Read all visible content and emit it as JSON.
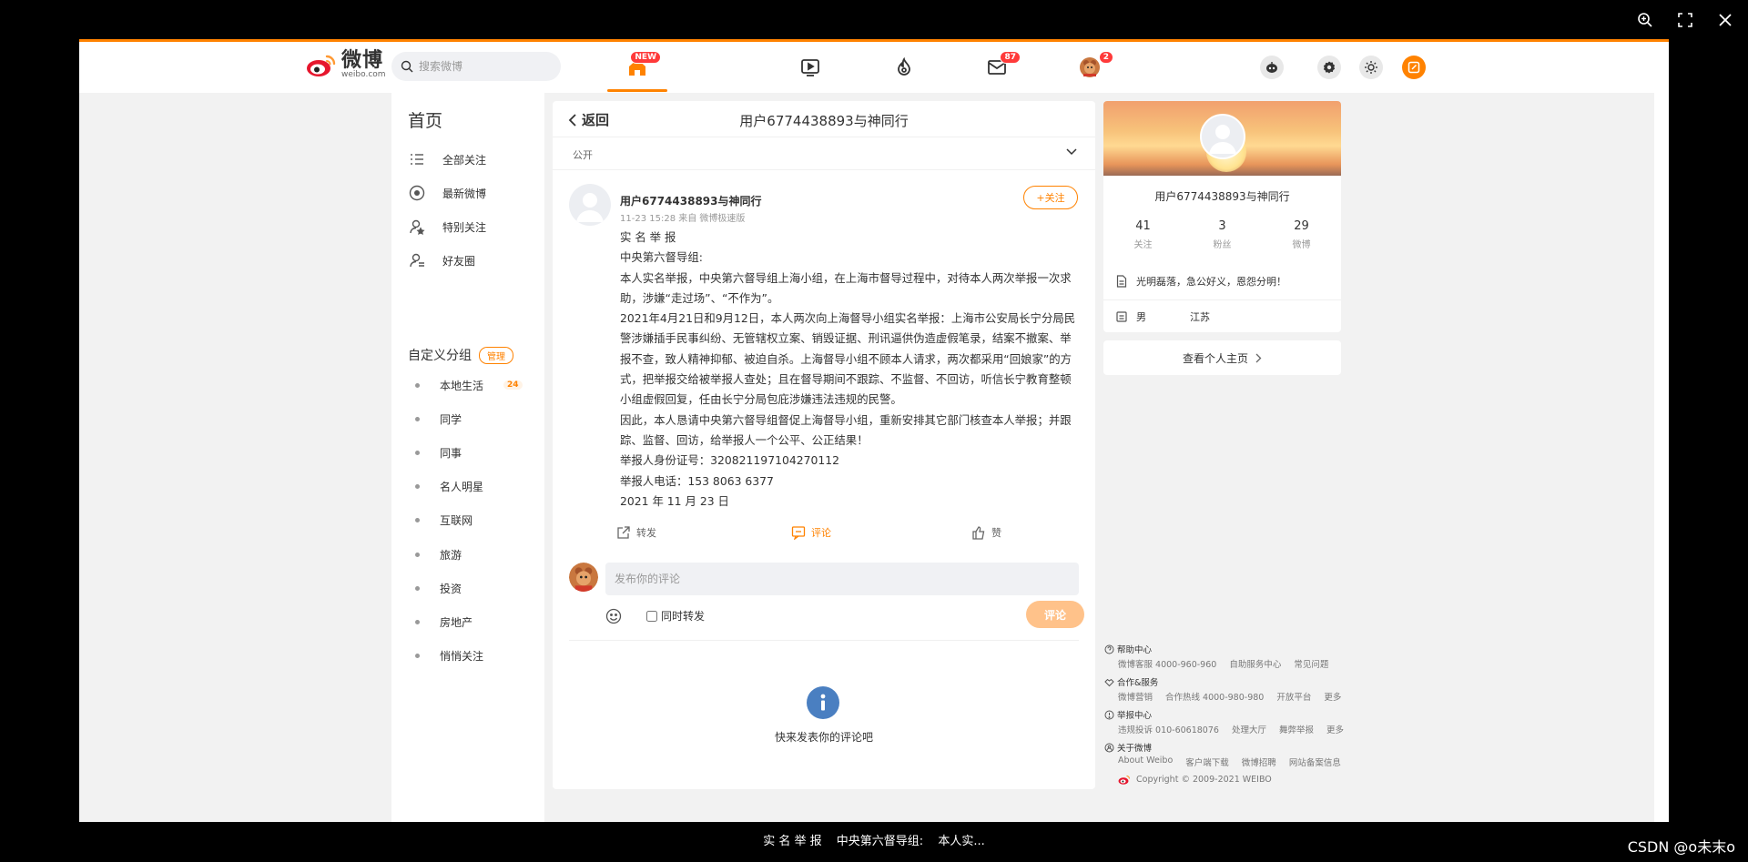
{
  "viewer": {
    "zoom_icon": "zoom-in-icon",
    "fullscreen_icon": "fullscreen-icon",
    "close_icon": "close-icon"
  },
  "topnav": {
    "logo_cn": "微博",
    "logo_en": "weibo.com",
    "search_placeholder": "搜索微博",
    "home_badge": "NEW",
    "mail_badge": "87",
    "avatar_badge": "2"
  },
  "leftnav": {
    "title": "首页",
    "items": [
      {
        "label": "全部关注",
        "icon": "list-icon"
      },
      {
        "label": "最新微博",
        "icon": "clock-icon"
      },
      {
        "label": "特别关注",
        "icon": "user-star-icon"
      },
      {
        "label": "好友圈",
        "icon": "friends-icon"
      }
    ],
    "group_title": "自定义分组",
    "manage_label": "管理",
    "groups": [
      {
        "label": "本地生活",
        "badge": "24"
      },
      {
        "label": "同学"
      },
      {
        "label": "同事"
      },
      {
        "label": "名人明星"
      },
      {
        "label": "互联网"
      },
      {
        "label": "旅游"
      },
      {
        "label": "投资"
      },
      {
        "label": "房地产"
      },
      {
        "label": "悄悄关注"
      }
    ]
  },
  "main": {
    "back_label": "返回",
    "title": "用户6774438893与神同行",
    "visibility": "公开",
    "post": {
      "author": "用户6774438893与神同行",
      "meta": "11-23 15:28  来自 微博极速版",
      "follow_label": "+关注",
      "lines": [
        "实 名 举 报",
        "中央第六督导组:",
        "本人实名举报，中央第六督导组上海小组，在上海市督导过程中，对待本人两次举报一次求助，涉嫌“走过场”、“不作为”。",
        "2021年4月21日和9月12日，本人两次向上海督导小组实名举报：上海市公安局长宁分局民警涉嫌插手民事纠纷、无管辖权立案、销毁证据、刑讯逼供伪造虚假笔录，结案不撤案、举报不查，致人精神抑郁、被迫自杀。上海督导小组不顾本人请求，两次都采用“回娘家”的方式，把举报交给被举报人查处；且在督导期间不跟踪、不监督、不回访，听信长宁教育整顿小组虚假回复，任由长宁分局包庇涉嫌违法违规的民警。",
        "因此，本人恳请中央第六督导组督促上海督导小组，重新安排其它部门核查本人举报；并跟踪、监督、回访，给举报人一个公平、公正结果！",
        "举报人身份证号：320821197104270112",
        "举报人电话：153 8063 6377",
        "2021 年 11 月 23 日"
      ],
      "repost_label": "转发",
      "comment_label": "评论",
      "like_label": "赞"
    },
    "comment_placeholder": "发布你的评论",
    "repost_toggle_label": "同时转发",
    "submit_label": "评论",
    "empty_text": "快来发表你的评论吧"
  },
  "profile": {
    "name": "用户6774438893与神同行",
    "stats": [
      {
        "num": "41",
        "label": "关注"
      },
      {
        "num": "3",
        "label": "粉丝"
      },
      {
        "num": "29",
        "label": "微博"
      }
    ],
    "bio": "光明磊落，急公好义，恩怨分明！",
    "gender": "男",
    "location": "江苏",
    "view_home_label": "查看个人主页"
  },
  "footer": {
    "help": {
      "title": "帮助中心",
      "links": [
        "微博客服 4000-960-960",
        "自助服务中心",
        "常见问题"
      ]
    },
    "coop": {
      "title": "合作&服务",
      "links": [
        "微博营销",
        "合作热线 4000-980-980",
        "开放平台",
        "更多"
      ]
    },
    "report": {
      "title": "举报中心",
      "links": [
        "违规投诉 010-60618076",
        "处理大厅",
        "舞弊举报",
        "更多"
      ]
    },
    "about": {
      "title": "关于微博",
      "links": [
        "About Weibo",
        "客户端下载",
        "微博招聘",
        "网站备案信息"
      ]
    },
    "copyright": "Copyright © 2009-2021 WEIBO"
  },
  "caption": {
    "parts": [
      "实 名 举 报",
      "中央第六督导组:",
      "本人实..."
    ]
  },
  "watermark": "CSDN @o未末o",
  "colors": {
    "accent": "#ff8200",
    "badge": "#ff3a3a",
    "info_blue": "#4a7fc1"
  }
}
